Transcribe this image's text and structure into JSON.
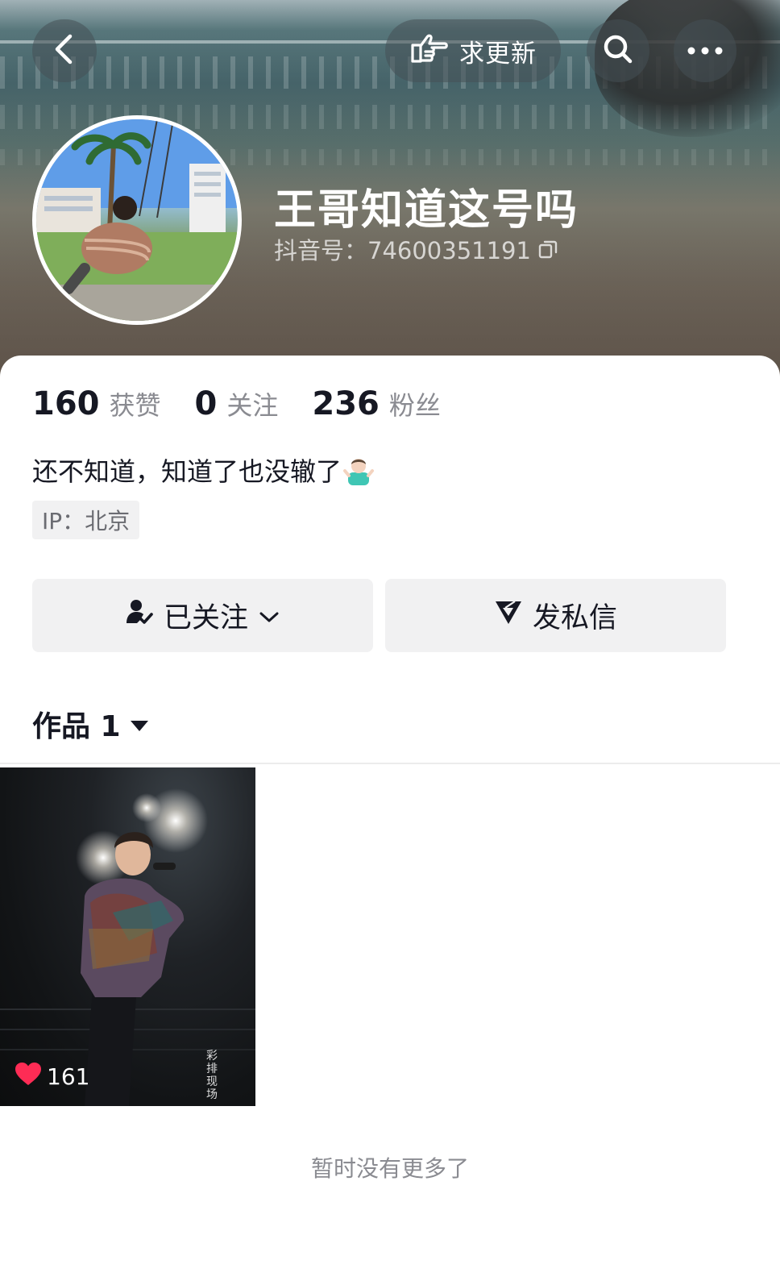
{
  "header": {
    "update_button_label": "求更新",
    "nickname": "王哥知道这号吗",
    "douyin_id": "抖音号：74600351191"
  },
  "stats": [
    {
      "number": "160",
      "label": "获赞"
    },
    {
      "number": "0",
      "label": "关注"
    },
    {
      "number": "236",
      "label": "粉丝"
    }
  ],
  "bio": {
    "text": "还不知道，知道了也没辙了",
    "emoji": "person-shrugging-emoji"
  },
  "ip_location": "IP：北京",
  "actions": {
    "follow_label": "已关注",
    "message_label": "发私信"
  },
  "works_tab": {
    "label": "作品 1"
  },
  "videos": [
    {
      "likes": "161",
      "watermark": "彩排现场"
    }
  ],
  "footer": {
    "no_more_text": "暂时没有更多了"
  },
  "colors": {
    "primary_text": "#161823",
    "secondary_text": "#8a8b91",
    "button_bg": "#f1f1f2",
    "like_red": "#fe2c55"
  },
  "icons": [
    "back-arrow-icon",
    "hand-point-icon",
    "search-icon",
    "more-dots-icon",
    "copy-icon",
    "person-check-icon",
    "chevron-down-icon",
    "send-plane-icon",
    "triangle-down-icon",
    "heart-icon"
  ]
}
